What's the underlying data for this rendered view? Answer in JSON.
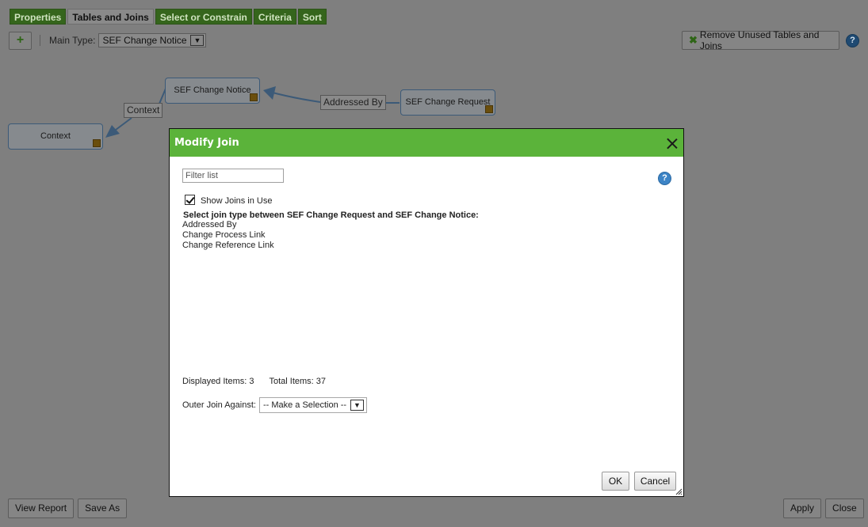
{
  "tabs": [
    {
      "label": "Properties",
      "active": false
    },
    {
      "label": "Tables and Joins",
      "active": true
    },
    {
      "label": "Select or Constrain",
      "active": false
    },
    {
      "label": "Criteria",
      "active": false
    },
    {
      "label": "Sort",
      "active": false
    }
  ],
  "toolbar": {
    "add_symbol": "+",
    "main_type_label": "Main Type:",
    "main_type_value": "SEF Change Notice",
    "remove_label": "Remove Unused Tables and Joins",
    "help_symbol": "?"
  },
  "diagram": {
    "nodes": [
      "SEF Change Notice",
      "SEF Change Request",
      "Context"
    ],
    "edges": [
      "Addressed By",
      "Context"
    ]
  },
  "footer": {
    "view_report": "View Report",
    "save_as": "Save As",
    "apply": "Apply",
    "close": "Close"
  },
  "dialog": {
    "title": "Modify Join",
    "filter_placeholder": "Filter list",
    "show_joins_label": "Show Joins in Use",
    "show_joins_checked": true,
    "heading": "Select join type between SEF Change Request and SEF Change Notice:",
    "joins": [
      "Addressed By",
      "Change Process Link",
      "Change Reference Link"
    ],
    "displayed_items": "Displayed Items: 3",
    "total_items": "Total Items: 37",
    "outer_join_label": "Outer Join Against:",
    "outer_join_value": "-- Make a Selection --",
    "ok_label": "OK",
    "cancel_label": "Cancel",
    "help_symbol": "?"
  },
  "colors": {
    "header_green": "#5bb33a",
    "overlay_gray": "#7f7f7f"
  }
}
